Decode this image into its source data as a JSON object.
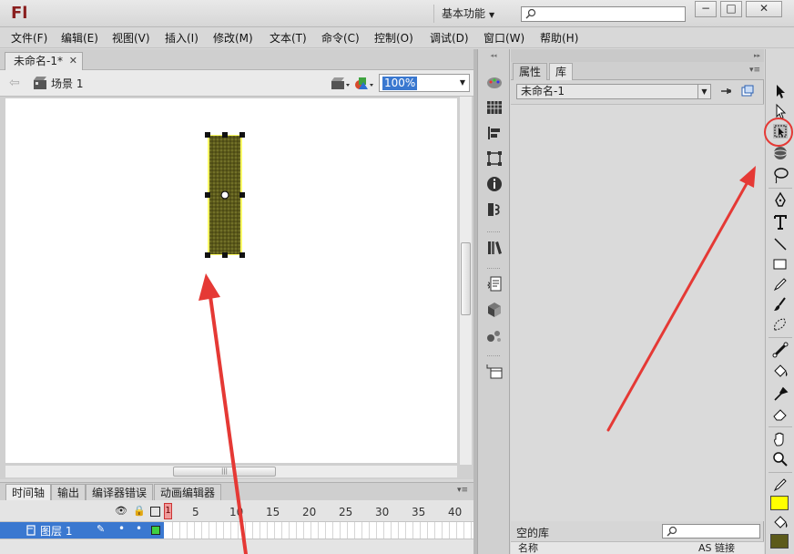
{
  "app": {
    "logo": "Fl",
    "workspace": "基本功能",
    "search_placeholder": ""
  },
  "window_controls": {
    "minimize": "−",
    "maximize": "□",
    "close": "✕"
  },
  "menu": [
    "文件(F)",
    "编辑(E)",
    "视图(V)",
    "插入(I)",
    "修改(M)",
    "文本(T)",
    "命令(C)",
    "控制(O)",
    "调试(D)",
    "窗口(W)",
    "帮助(H)"
  ],
  "document": {
    "tab_title": "未命名-1*",
    "scene": "场景 1",
    "zoom": "100%"
  },
  "stage_object": {
    "kind": "rectangle",
    "fill": "#5c5a1a",
    "selected": true
  },
  "timeline": {
    "tabs": [
      "时间轴",
      "输出",
      "编译器错误",
      "动画编辑器"
    ],
    "frame_numbers": [
      "1",
      "5",
      "10",
      "15",
      "20",
      "25",
      "30",
      "35",
      "40"
    ],
    "layer_name": "图层 1",
    "current_frame": "1"
  },
  "library": {
    "tabs": [
      "属性",
      "库"
    ],
    "active_tab": "库",
    "document_select": "未命名-1",
    "status": "空的库",
    "columns": [
      "名称",
      "AS 链接"
    ]
  },
  "icon_dock": [
    "color-icon",
    "swatches-icon",
    "align-icon",
    "transform-icon",
    "info-icon",
    "scene-icon",
    "components-icon",
    "actions-icon",
    "code-snippets-icon",
    "behaviors-icon",
    "movie-explorer-icon"
  ],
  "tools": [
    "selection-tool-icon",
    "subselection-tool-icon",
    "free-transform-tool-icon",
    "3d-rotation-tool-icon",
    "lasso-tool-icon",
    "pen-tool-icon",
    "text-tool-icon",
    "line-tool-icon",
    "rectangle-tool-icon",
    "pencil-tool-icon",
    "brush-tool-icon",
    "deco-tool-icon",
    "bone-tool-icon",
    "paint-bucket-tool-icon",
    "eyedropper-tool-icon",
    "eraser-tool-icon",
    "hand-tool-icon",
    "zoom-tool-icon",
    "stroke-color-icon",
    "fill-color-icon"
  ],
  "colors": {
    "stroke": "#ffff00",
    "fill": "#5c5a1a",
    "selection": "#3a78d0",
    "annotation": "#e53935"
  },
  "annotations": {
    "highlighted_tool": "free-transform-tool-icon"
  }
}
